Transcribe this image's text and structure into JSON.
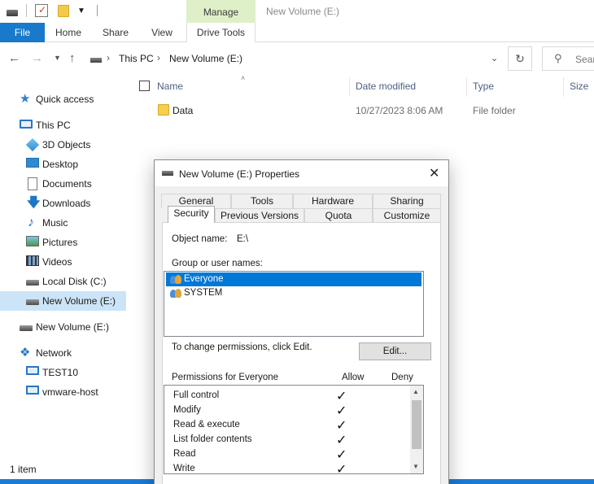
{
  "window": {
    "title": "New Volume (E:)",
    "context_tab": "Manage"
  },
  "ribbon": {
    "tabs": [
      "File",
      "Home",
      "Share",
      "View",
      "Drive Tools"
    ]
  },
  "address": {
    "crumbs": [
      "This PC",
      "New Volume (E:)"
    ],
    "search_placeholder": "Sear"
  },
  "sidebar": {
    "items": [
      {
        "label": "Quick access",
        "icon": "star-icon"
      },
      {
        "label": "This PC",
        "icon": "computer-icon"
      },
      {
        "label": "3D Objects",
        "icon": "3d-objects-icon"
      },
      {
        "label": "Desktop",
        "icon": "desktop-icon"
      },
      {
        "label": "Documents",
        "icon": "documents-icon"
      },
      {
        "label": "Downloads",
        "icon": "downloads-icon"
      },
      {
        "label": "Music",
        "icon": "music-icon"
      },
      {
        "label": "Pictures",
        "icon": "pictures-icon"
      },
      {
        "label": "Videos",
        "icon": "videos-icon"
      },
      {
        "label": "Local Disk (C:)",
        "icon": "disk-icon"
      },
      {
        "label": "New Volume (E:)",
        "icon": "drive-icon"
      },
      {
        "label": "New Volume (E:)",
        "icon": "drive-icon"
      },
      {
        "label": "Network",
        "icon": "network-icon"
      },
      {
        "label": "TEST10",
        "icon": "monitor-icon"
      },
      {
        "label": "vmware-host",
        "icon": "monitor-icon"
      }
    ]
  },
  "files": {
    "columns": [
      "Name",
      "Date modified",
      "Type",
      "Size"
    ],
    "rows": [
      {
        "name": "Data",
        "date": "10/27/2023 8:06 AM",
        "type": "File folder",
        "size": ""
      }
    ]
  },
  "status": {
    "item_count": "1 item"
  },
  "dialog": {
    "title": "New Volume (E:) Properties",
    "tabs_row1": [
      "General",
      "Tools",
      "Hardware",
      "Sharing"
    ],
    "tabs_row2": [
      "Security",
      "Previous Versions",
      "Quota",
      "Customize"
    ],
    "object_name_label": "Object name:",
    "object_name_value": "E:\\",
    "group_label": "Group or user names:",
    "users": [
      "Everyone",
      "SYSTEM"
    ],
    "change_hint": "To change permissions, click Edit.",
    "edit_button": "Edit...",
    "permissions_label": "Permissions for Everyone",
    "allow_header": "Allow",
    "deny_header": "Deny",
    "permissions": [
      {
        "name": "Full control",
        "allow": true
      },
      {
        "name": "Modify",
        "allow": true
      },
      {
        "name": "Read & execute",
        "allow": true
      },
      {
        "name": "List folder contents",
        "allow": true
      },
      {
        "name": "Read",
        "allow": true
      },
      {
        "name": "Write",
        "allow": true
      }
    ],
    "check_glyph": "✓"
  }
}
